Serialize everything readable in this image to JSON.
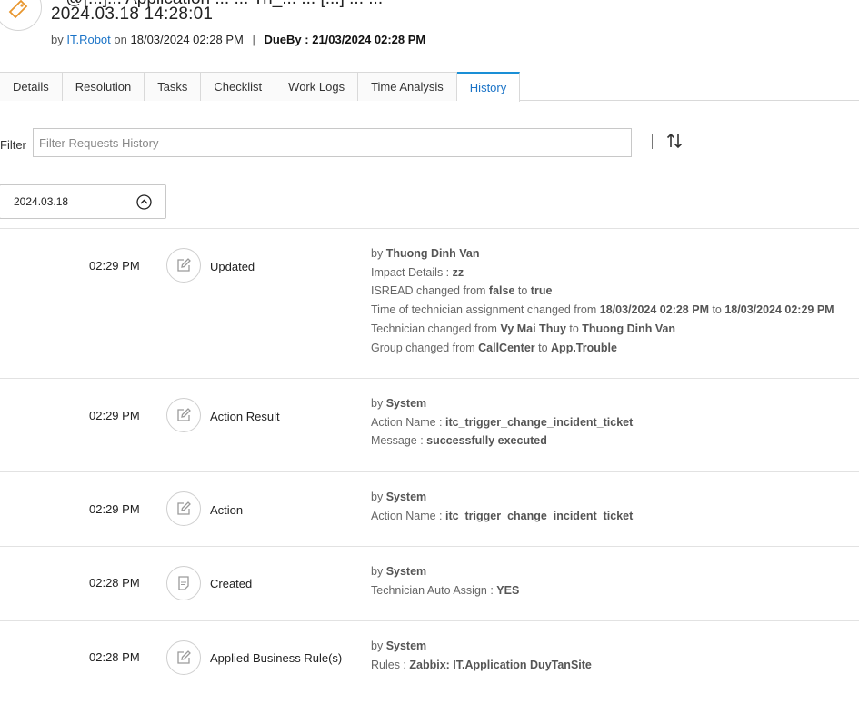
{
  "header": {
    "title_top": "~ @[...]... Application ... ... Tri_... ... [...] ... ...",
    "title_date": "2024.03.18 14:28:01",
    "by_label": "by",
    "author": "IT.Robot",
    "on_label": "on",
    "created_at": "18/03/2024 02:28 PM",
    "separator": "|",
    "dueby_label": "DueBy :",
    "dueby_value": "21/03/2024 02:28 PM"
  },
  "tabs": [
    {
      "label": "Details"
    },
    {
      "label": "Resolution"
    },
    {
      "label": "Tasks"
    },
    {
      "label": "Checklist"
    },
    {
      "label": "Work Logs"
    },
    {
      "label": "Time Analysis"
    },
    {
      "label": "History",
      "active": true
    }
  ],
  "filter": {
    "label": "Filter",
    "placeholder": "Filter Requests History"
  },
  "date_group": "2024.03.18",
  "colors": {
    "accent": "#1a73c7",
    "active_tab_border": "#1a8fd6"
  },
  "entries": [
    {
      "time": "02:29 PM",
      "icon": "edit-icon",
      "action": "Updated",
      "lines": [
        {
          "prefix": "by ",
          "bold": "Thuong Dinh Van"
        },
        {
          "prefix": "Impact Details : ",
          "bold": "zz"
        },
        {
          "prefix": "ISREAD changed from ",
          "bold": "false",
          "mid": " to ",
          "bold2": "true"
        },
        {
          "prefix": "Time of technician assignment changed from ",
          "bold": "18/03/2024 02:28 PM",
          "mid": " to ",
          "bold2": "18/03/2024 02:29 PM"
        },
        {
          "prefix": "Technician changed from ",
          "bold": "Vy Mai Thuy",
          "mid": " to ",
          "bold2": "Thuong Dinh Van"
        },
        {
          "prefix": "Group changed from ",
          "bold": "CallCenter",
          "mid": " to ",
          "bold2": "App.Trouble"
        }
      ]
    },
    {
      "time": "02:29 PM",
      "icon": "edit-icon",
      "action": "Action Result",
      "lines": [
        {
          "prefix": "by ",
          "bold": "System"
        },
        {
          "prefix": "Action Name : ",
          "bold": "itc_trigger_change_incident_ticket"
        },
        {
          "prefix": "Message : ",
          "bold": "successfully executed"
        }
      ]
    },
    {
      "time": "02:29 PM",
      "icon": "edit-icon",
      "action": "Action",
      "lines": [
        {
          "prefix": "by ",
          "bold": "System"
        },
        {
          "prefix": "Action Name : ",
          "bold": "itc_trigger_change_incident_ticket"
        }
      ]
    },
    {
      "time": "02:28 PM",
      "icon": "document-icon",
      "action": "Created",
      "lines": [
        {
          "prefix": "by ",
          "bold": "System"
        },
        {
          "prefix": "Technician Auto Assign : ",
          "bold": "YES"
        }
      ]
    },
    {
      "time": "02:28 PM",
      "icon": "edit-icon",
      "action": "Applied Business Rule(s)",
      "lines": [
        {
          "prefix": "by ",
          "bold": "System"
        },
        {
          "prefix": "Rules : ",
          "bold": "Zabbix: IT.Application DuyTanSite"
        }
      ]
    }
  ]
}
